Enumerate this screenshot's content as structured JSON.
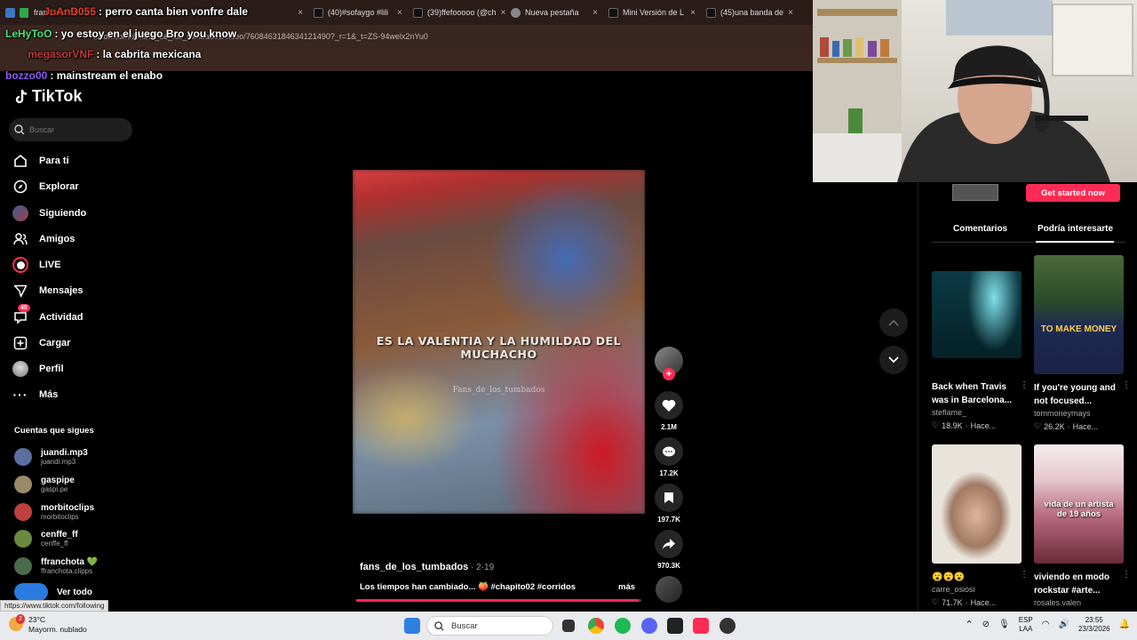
{
  "browser": {
    "tabs": [
      {
        "label": "(40)#sofaygo #lili",
        "close": "×"
      },
      {
        "label": "(39)ffefooooo (@ch",
        "close": "×"
      },
      {
        "label": "Nueva pestaña",
        "close": "×"
      },
      {
        "label": "Mini Versión de L",
        "close": "×"
      },
      {
        "label": "(45)una banda de",
        "close": "×"
      }
    ],
    "first_tab_label": "franchota Stream",
    "url": "tiktok.com/@fans_de_los_tumbados/video/7608463184634121490?_r=1&_t=ZS-94welx2nYu0"
  },
  "chat": [
    {
      "user": "JuAnD055",
      "color": "#e63c2e",
      "message": "perro canta bien vonfre dale"
    },
    {
      "user": "LeHyToO",
      "color": "#4fe07a",
      "message": "yo estoy en el juego Bro you know"
    },
    {
      "user": "megasorVNF",
      "color": "#c23a3a",
      "message": "la cabrita mexicana"
    },
    {
      "user": "bozzo00",
      "color": "#8a5cf0",
      "message": "mainstream el enabo"
    }
  ],
  "tiktok": {
    "logo": "TikTok",
    "search_placeholder": "Buscar",
    "nav": [
      {
        "label": "Para ti",
        "icon": "home-icon"
      },
      {
        "label": "Explorar",
        "icon": "compass-icon"
      },
      {
        "label": "Siguiendo",
        "icon": "following-icon"
      },
      {
        "label": "Amigos",
        "icon": "friends-icon"
      },
      {
        "label": "LIVE",
        "icon": "live-icon"
      },
      {
        "label": "Mensajes",
        "icon": "messages-icon"
      },
      {
        "label": "Actividad",
        "icon": "activity-icon",
        "badge": "45"
      },
      {
        "label": "Cargar",
        "icon": "upload-icon"
      },
      {
        "label": "Perfil",
        "icon": "profile-icon"
      },
      {
        "label": "Más",
        "icon": "more-icon"
      }
    ],
    "following_title": "Cuentas que sigues",
    "following": [
      {
        "name": "juandi.mp3",
        "handle": "juandi.mp3",
        "color": "#5a6fa0"
      },
      {
        "name": "gaspipe",
        "handle": "gaspi.pe",
        "color": "#9a8a6a"
      },
      {
        "name": "morbitoclips",
        "handle": "morbitoclips",
        "color": "#c04040"
      },
      {
        "name": "cenffe_ff",
        "handle": "cenffe_ff",
        "color": "#6a8a40"
      },
      {
        "name": "ffranchota 💚",
        "handle": "ffranchota.clipps",
        "color": "#4a6a4a"
      },
      {
        "name": "Ver todo",
        "handle": "",
        "color": "#2a7be0"
      }
    ],
    "status_link": "https://www.tiktok.com/following",
    "video": {
      "caption": "ES LA VALENTIA Y LA HUMILDAD DEL MUCHACHO",
      "watermark": "Fans_de_los_tumbados",
      "author": "fans_de_los_tumbados",
      "date": " · 2-19",
      "description": "Los tiempos han cambiado... 🍑 #chapito02 #corridos",
      "more": "más",
      "progress": 0.99
    },
    "actions": [
      {
        "icon": "heart-icon",
        "count": "2.1M"
      },
      {
        "icon": "comment-icon",
        "count": "17.2K"
      },
      {
        "icon": "bookmark-icon",
        "count": "197.7K"
      },
      {
        "icon": "share-icon",
        "count": "970.3K"
      }
    ],
    "right_panel": {
      "get_started": "Get started now",
      "tabs": [
        "Comentarios",
        "Podría interesarte"
      ],
      "cards": [
        {
          "title": "Back when Travis was in Barcelona...",
          "author": "steflame_",
          "likes": "18.9K",
          "time": "Hace...",
          "overlay": ""
        },
        {
          "title": "If you're young and not focused...",
          "author": "tommoneymays",
          "likes": "26.2K",
          "time": "Hace...",
          "overlay": "TO MAKE MONEY"
        },
        {
          "title": "😮😮😮",
          "author": "carre_osiosi",
          "likes": "71.7K",
          "time": "Hace...",
          "overlay": ""
        },
        {
          "title": "viviendo en modo rockstar #arte...",
          "author": "rosales.valen",
          "likes": "",
          "time": "",
          "overlay": "vida de un artista de 19 años"
        }
      ]
    }
  },
  "taskbar": {
    "weather_temp": "23°C",
    "weather_desc": "Mayorm. nublado",
    "weather_badge": "2",
    "search_placeholder": "Buscar",
    "lang_top": "ESP",
    "lang_bottom": "LAA",
    "time": "23:55",
    "date": "23/3/2026"
  }
}
